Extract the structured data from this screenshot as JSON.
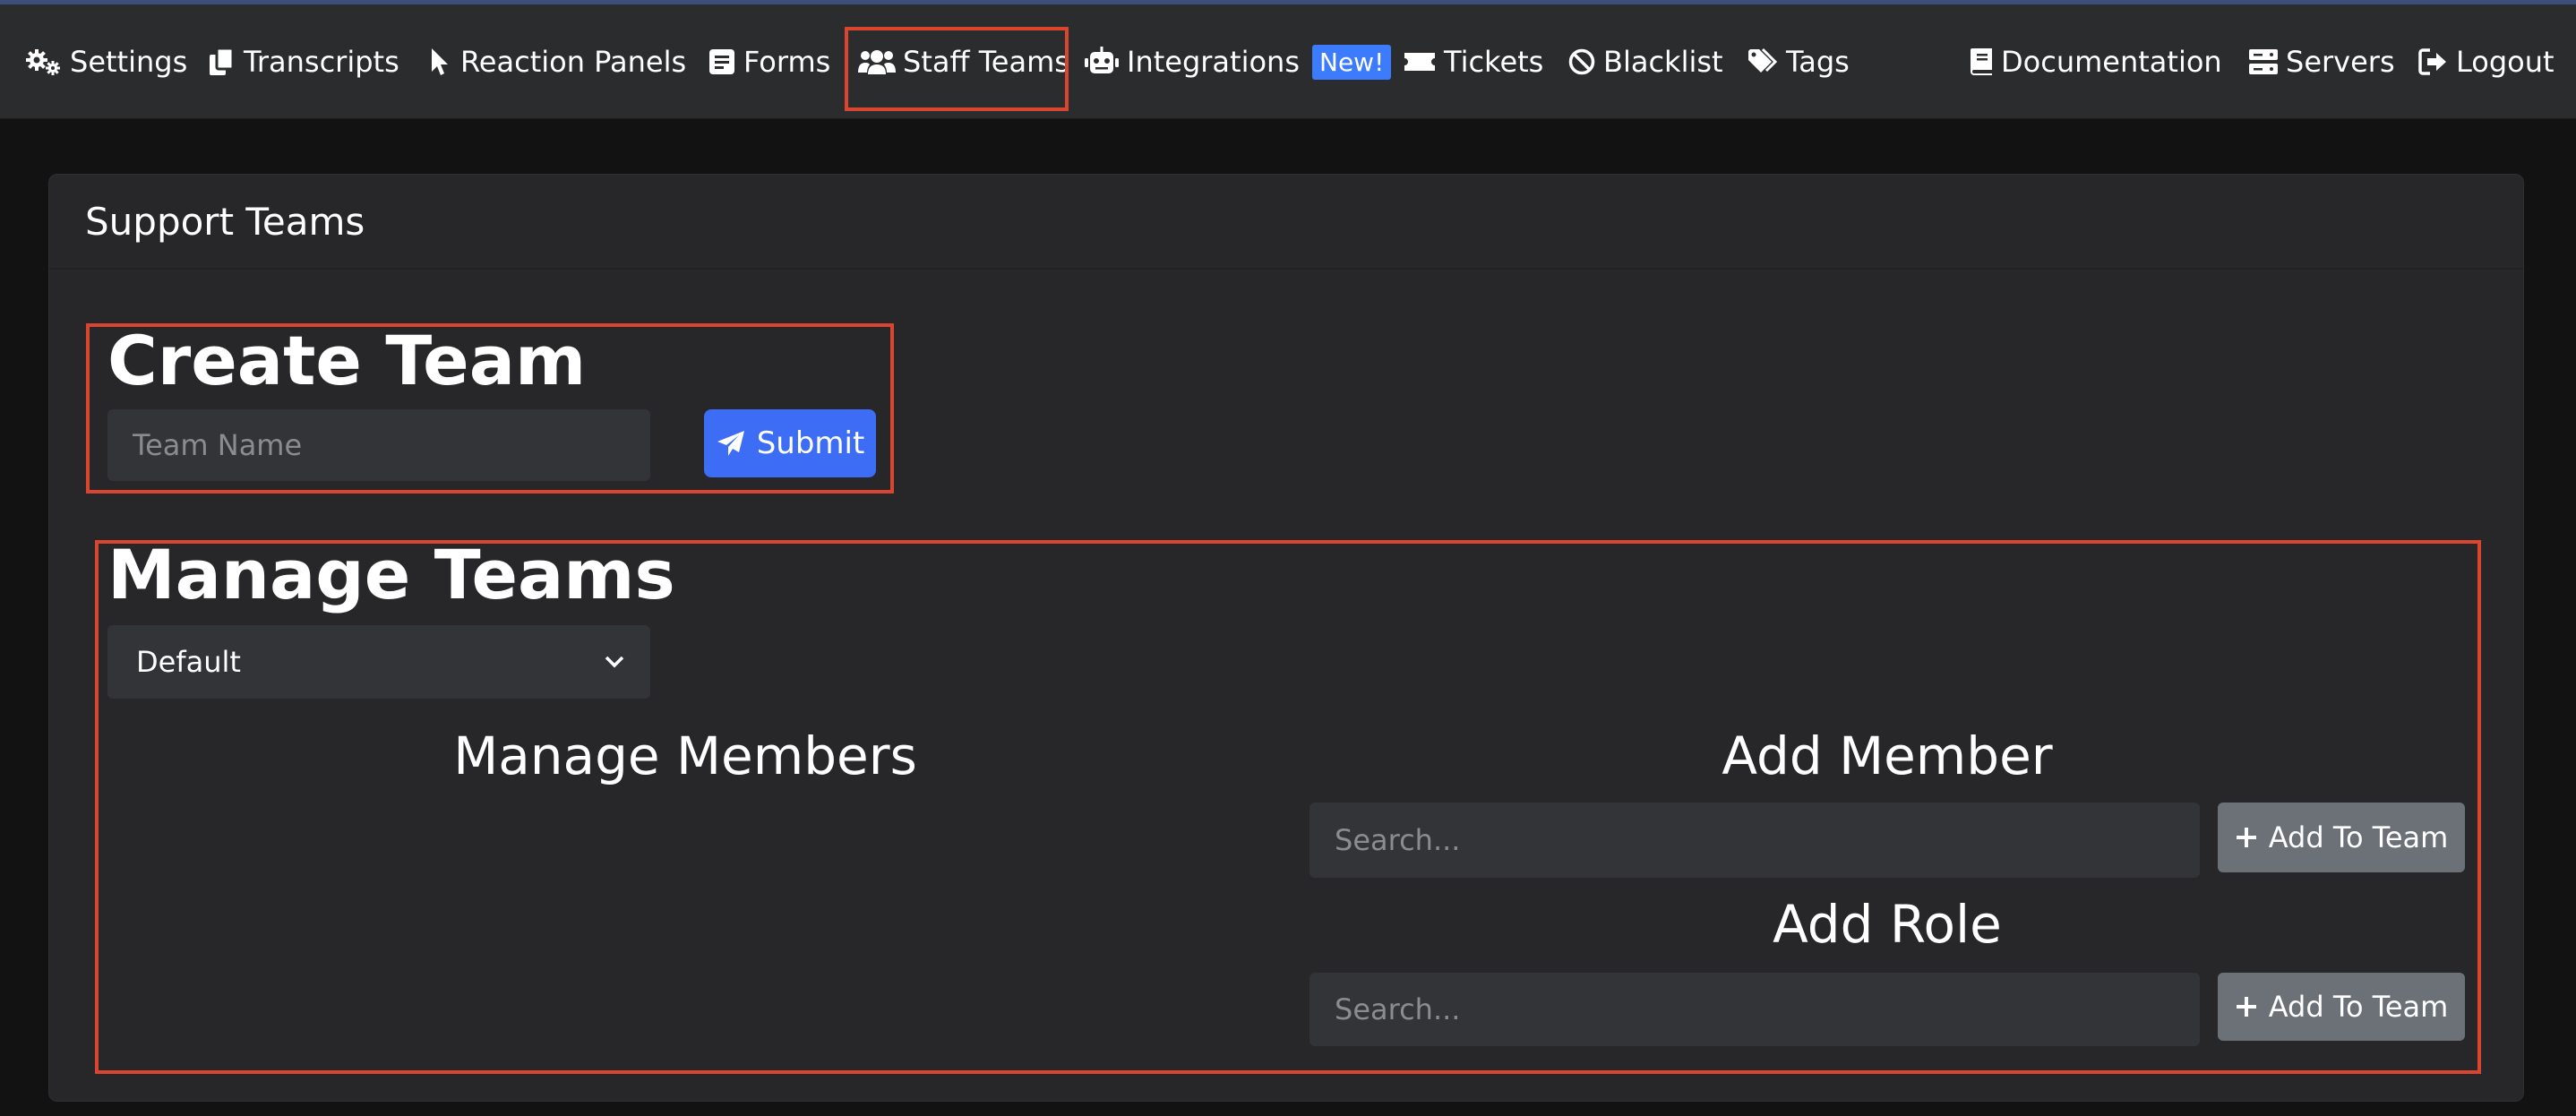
{
  "nav": {
    "left": [
      {
        "label": "Settings",
        "icon": "gears-icon"
      },
      {
        "label": "Transcripts",
        "icon": "copy-icon"
      },
      {
        "label": "Reaction Panels",
        "icon": "pointer-icon"
      },
      {
        "label": "Forms",
        "icon": "form-icon"
      },
      {
        "label": "Staff Teams",
        "icon": "users-icon"
      },
      {
        "label": "Integrations",
        "icon": "robot-icon",
        "badge": "New!"
      },
      {
        "label": "Tickets",
        "icon": "ticket-icon"
      },
      {
        "label": "Blacklist",
        "icon": "ban-icon"
      },
      {
        "label": "Tags",
        "icon": "tags-icon"
      }
    ],
    "right": [
      {
        "label": "Documentation",
        "icon": "book-icon"
      },
      {
        "label": "Servers",
        "icon": "server-icon"
      },
      {
        "label": "Logout",
        "icon": "logout-icon"
      }
    ]
  },
  "card": {
    "title": "Support Teams"
  },
  "create_team": {
    "heading": "Create Team",
    "name_placeholder": "Team Name",
    "submit_label": "Submit"
  },
  "manage_teams": {
    "heading": "Manage Teams",
    "selected_team": "Default",
    "members_heading": "Manage Members",
    "add_member_heading": "Add Member",
    "add_member_placeholder": "Search...",
    "add_member_button": "Add To Team",
    "add_role_heading": "Add Role",
    "add_role_placeholder": "Search...",
    "add_role_button": "Add To Team"
  },
  "colors": {
    "accent": "#3d6cf5",
    "highlight": "#d9452e",
    "badge": "#3d7bfd"
  }
}
